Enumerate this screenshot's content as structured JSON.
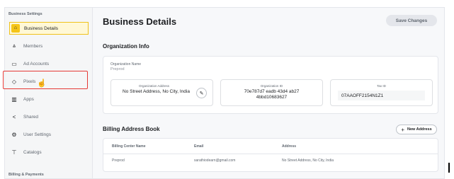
{
  "sidebar": {
    "section_header": "Business Settings",
    "items": [
      {
        "label": "Business Details",
        "icon": "home-icon",
        "glyph": "⌂"
      },
      {
        "label": "Members",
        "icon": "members-icon",
        "glyph": "⩓"
      },
      {
        "label": "Ad Accounts",
        "icon": "folder-icon",
        "glyph": "▭"
      },
      {
        "label": "Pixels",
        "icon": "pixel-icon",
        "glyph": "◇"
      },
      {
        "label": "Apps",
        "icon": "apps-icon",
        "glyph": "▥"
      },
      {
        "label": "Shared",
        "icon": "share-icon",
        "glyph": "<"
      },
      {
        "label": "User Settings",
        "icon": "gear-icon",
        "glyph": "⚙"
      },
      {
        "label": "Catalogs",
        "icon": "catalog-icon",
        "glyph": "⊤"
      }
    ],
    "footer_header": "Billing & Payments",
    "cursor_glyph": "☝"
  },
  "header": {
    "title": "Business Details",
    "save_label": "Save Changes"
  },
  "org_info": {
    "section_title": "Organization Info",
    "name_label": "Organization Name",
    "name_value": "Preprod",
    "address_label": "Organization Address",
    "address_value": "No Street Address, No City, India",
    "edit_glyph": "✎",
    "id_label": "Organization ID",
    "id_value": "70e787d7 eadb 43d4 ab27 4bbd10683627",
    "tax_label": "Tax ID",
    "tax_value": "07AAOFF2154N1Z1"
  },
  "billing": {
    "section_title": "Billing Address Book",
    "new_address_label": "New Address",
    "plus_glyph": "+",
    "columns": [
      "Billing Center Name",
      "Email",
      "Address"
    ],
    "rows": [
      [
        "Preprod",
        "sarathiodearn@gmail.com",
        "No Street Address, No City, India"
      ]
    ]
  },
  "colors": {
    "accent": "#f5c518",
    "highlight": "#e53935"
  }
}
